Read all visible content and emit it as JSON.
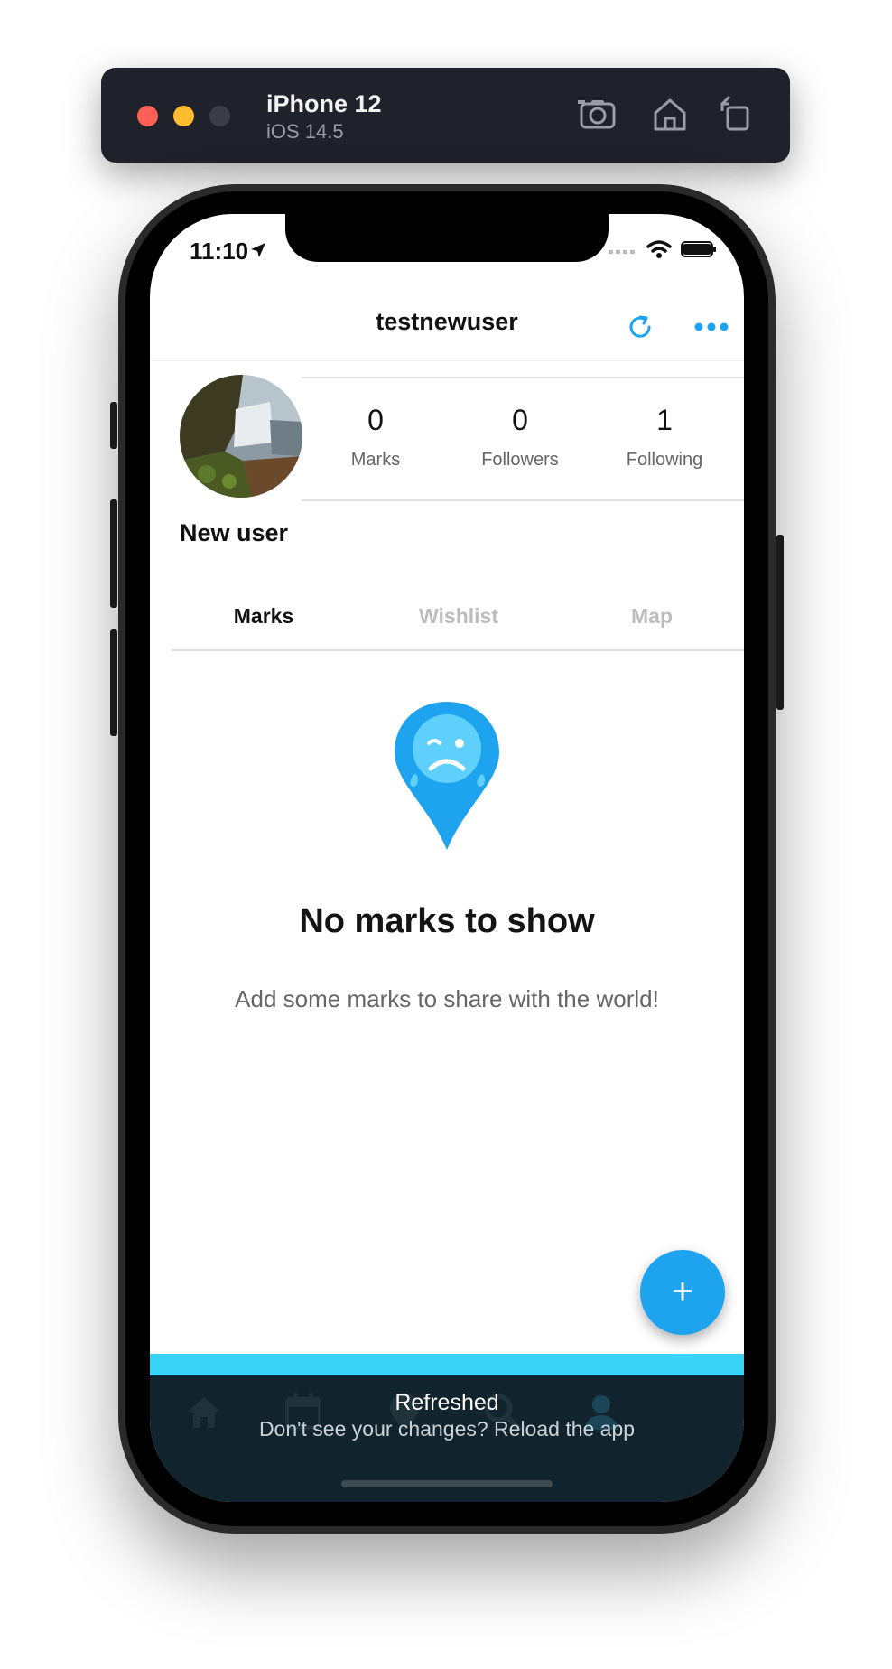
{
  "simulator": {
    "device_name": "iPhone 12",
    "os_version": "iOS 14.5",
    "buttons": [
      "screenshot-icon",
      "home-icon",
      "rotate-icon"
    ]
  },
  "status_bar": {
    "time": "11:10"
  },
  "header": {
    "title": "testnewuser"
  },
  "profile": {
    "display_name": "New user",
    "stats": [
      {
        "value": "0",
        "label": "Marks"
      },
      {
        "value": "0",
        "label": "Followers"
      },
      {
        "value": "1",
        "label": "Following"
      }
    ]
  },
  "tabs": [
    {
      "label": "Marks",
      "active": true
    },
    {
      "label": "Wishlist",
      "active": false
    },
    {
      "label": "Map",
      "active": false
    }
  ],
  "empty_state": {
    "title": "No marks to show",
    "subtitle": "Add some marks to share with the world!"
  },
  "fab": {
    "label": "+"
  },
  "toast": {
    "title": "Refreshed",
    "message": "Don't see your changes? Reload the app"
  },
  "bottom_nav": [
    "home-icon",
    "calendar-icon",
    "marker-icon",
    "search-icon",
    "profile-icon"
  ],
  "colors": {
    "accent": "#1ea4ee",
    "toast_bg": "#11232c",
    "toast_strip": "#39d3f8",
    "active_tab": "#111111",
    "inactive_tab": "#bdbdbd"
  }
}
